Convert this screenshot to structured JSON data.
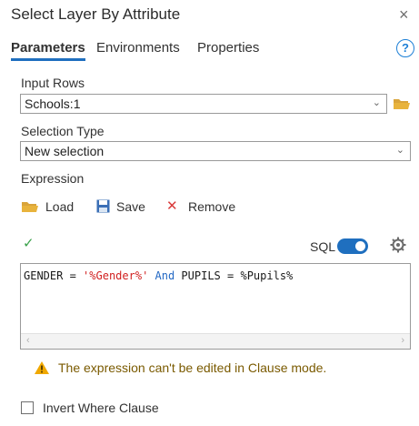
{
  "dialog": {
    "title": "Select Layer By Attribute",
    "close_glyph": "×"
  },
  "tabs": [
    {
      "label": "Parameters",
      "active": true
    },
    {
      "label": "Environments",
      "active": false
    },
    {
      "label": "Properties",
      "active": false
    }
  ],
  "help_glyph": "?",
  "input_rows": {
    "label": "Input Rows",
    "value": "Schools:1",
    "chevron": "⌄"
  },
  "selection_type": {
    "label": "Selection Type",
    "value": "New selection",
    "chevron": "⌄"
  },
  "expression": {
    "label": "Expression",
    "load_label": "Load",
    "save_label": "Save",
    "remove_label": "Remove",
    "remove_glyph": "✕",
    "check_glyph": "✓",
    "sql_label": "SQL",
    "sql_toggle_on": true,
    "parts": {
      "field1": "GENDER",
      "eq1": " = ",
      "str1": "'%Gender%'",
      "and": " And ",
      "field2": "PUPILS",
      "eq2": " = ",
      "val2": "%Pupils%"
    },
    "scroll_left": "‹",
    "scroll_right": "›"
  },
  "warning": {
    "text": "The expression can't be edited in Clause mode."
  },
  "invert": {
    "label": "Invert Where Clause",
    "checked": false
  },
  "colors": {
    "accent": "#1f6fbf",
    "folder": "#e8b33c",
    "check_green": "#3aa14a",
    "remove_red": "#d93a3a",
    "warning": "#f0a800"
  }
}
